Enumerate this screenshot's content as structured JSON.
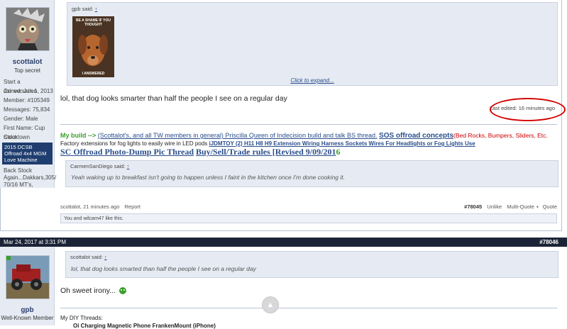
{
  "post1": {
    "user": {
      "name": "scottalot",
      "title": "Top secret",
      "start_conversation": "Start a Conversation",
      "joined": "Joined: Jun 1, 2013",
      "member": "Member: #105349",
      "messages": "Messages: 75,834",
      "gender": "Gender: Male",
      "first_name": "First Name: Cup Cake",
      "location": "Stocktown",
      "badge": "2015 DCSB Offroad 4x4 MGM Love Machine",
      "back_stock": "Back Stock Again...Dakkars,305/ 70/16 MT's,"
    },
    "quote": {
      "author": "gpb said:",
      "arrow": "↑",
      "image_top_text": "BE A SHAME IF YOU THOUGHT",
      "image_bottom_text": "I ANSWERED",
      "expand": "Click to expand..."
    },
    "message": "lol, that dog looks smarter than half the people I see on a regular day",
    "last_edited": "Last edited: 16 minutes ago",
    "signature": {
      "my_build_label": "My build -->",
      "build_link": "(Scottalot's, and all TW members in general) Priscilla Queen of Indecision build and talk BS thread.",
      "sos_link": "SOS offroad concepts",
      "sos_suffix": "(Bed Rocks, Bumpers, Sliders, Etc.",
      "fog_text": "Factory extensions for fog lights to easily wire in LED pods",
      "fog_link": "iJDMTOY (2) H11 H8 H9 Extension Wiring Harness Sockets Wires For Headlights or Fog Lights Use",
      "sc_offroad": "SC Offroad Photo-Dump Pic Thread",
      "bst": "Buy/Sell/Trade rules [Revised 9/09/201",
      "bst_end": "6",
      "inner_quote_author": "CarmenSanDiego said:",
      "inner_quote_arrow": "↑",
      "inner_quote_text": "Yeah waking up to breakfast isn't going to happen unless I faint in the kitchen once I'm done cooking it."
    },
    "footer": {
      "author": "scottalot,",
      "time": "21 minutes ago",
      "report": "Report",
      "post_number": "#78045",
      "unlike": "Unlike",
      "multi_quote": "Multi-Quote",
      "multi_quote_sep": "+",
      "quote": "Quote"
    },
    "likes": "You and wilcam47 like this."
  },
  "post2": {
    "date": "Mar 24, 2017 at 3:31 PM",
    "post_number": "#78046",
    "user": {
      "name": "gpb",
      "title": "Well-Known Member"
    },
    "quote": {
      "author": "scottalot said:",
      "arrow": "↑",
      "text": "lol, that dog looks smarted than half the people I see on a regular day"
    },
    "message": "Oh sweet irony...",
    "diy_label": "My DIY Threads:",
    "diy_item": "Oi Charging Magnetic Phone FrankenMount (iPhone)"
  },
  "scroll_top": "▲",
  "colors": {
    "accent": "#2a4e8c",
    "green": "#3aa02b",
    "red_circle": "#d40000",
    "sos_red": "#cc0000"
  }
}
